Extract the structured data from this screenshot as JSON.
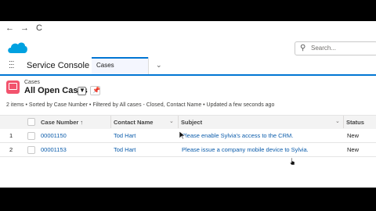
{
  "browser": {
    "back": "←",
    "forward": "→",
    "reload": "C"
  },
  "header": {
    "search_placeholder": "Search..."
  },
  "appbar": {
    "app_name": "Service Console",
    "tab_label": "Cases"
  },
  "list": {
    "object_label": "Cases",
    "list_name": "All Open Cases",
    "meta": "2 items • Sorted by Case Number • Filtered by All cases - Closed, Contact Name • Updated a few seconds ago"
  },
  "table": {
    "columns": {
      "case_number": "Case Number ↑",
      "contact_name": "Contact Name",
      "subject": "Subject",
      "status": "Status"
    },
    "rows": [
      {
        "index": "1",
        "case_number": "00001150",
        "contact_name": "Tod Hart",
        "subject": "Please enable Sylvia's access to the CRM.",
        "status": "New"
      },
      {
        "index": "2",
        "case_number": "00001153",
        "contact_name": "Tod Hart",
        "subject": "Please issue a company mobile device to Sylvia.",
        "status": "New"
      }
    ]
  },
  "colors": {
    "brand": "#0176d3",
    "cases_icon": "#f2536d",
    "link": "#0b5cab"
  }
}
